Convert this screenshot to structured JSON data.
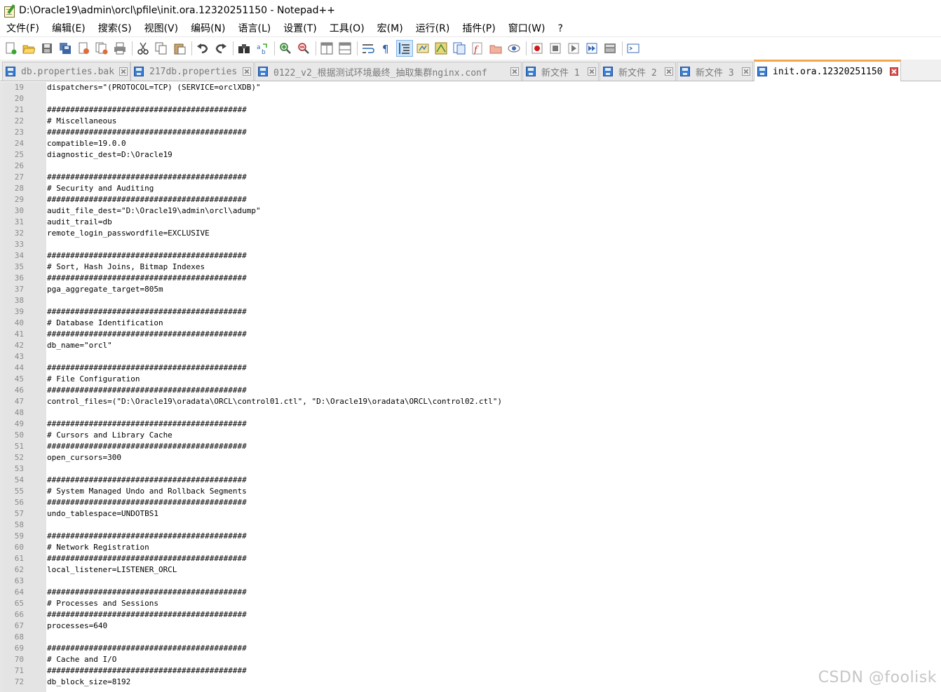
{
  "window": {
    "title": "D:\\Oracle19\\admin\\orcl\\pfile\\init.ora.12320251150 - Notepad++"
  },
  "menu": [
    {
      "label": "文件(F)"
    },
    {
      "label": "编辑(E)"
    },
    {
      "label": "搜索(S)"
    },
    {
      "label": "视图(V)"
    },
    {
      "label": "编码(N)"
    },
    {
      "label": "语言(L)"
    },
    {
      "label": "设置(T)"
    },
    {
      "label": "工具(O)"
    },
    {
      "label": "宏(M)"
    },
    {
      "label": "运行(R)"
    },
    {
      "label": "插件(P)"
    },
    {
      "label": "窗口(W)"
    },
    {
      "label": "?"
    }
  ],
  "toolbar": {
    "buttons": [
      "new-file-icon",
      "open-file-icon",
      "save-icon",
      "save-all-icon",
      "close-icon",
      "close-all-icon",
      "print-icon",
      "cut-icon",
      "copy-icon",
      "paste-icon",
      "undo-icon",
      "redo-icon",
      "find-icon",
      "replace-icon",
      "zoom-in-icon",
      "zoom-out-icon",
      "sync-vertical-icon",
      "sync-horizontal-icon",
      "word-wrap-icon",
      "show-all-chars-icon",
      "indent-guide-icon",
      "udl-icon",
      "doc-map-icon",
      "function-list-icon",
      "folder-workspace-icon",
      "monitor-icon",
      "record-macro-icon",
      "stop-record-icon",
      "play-macro-icon",
      "run-macro-multiple-icon",
      "save-macro-icon",
      "console-icon"
    ]
  },
  "tabs": [
    {
      "label": "db.properties.bak",
      "active": false
    },
    {
      "label": "217db.properties",
      "active": false
    },
    {
      "label": "0122_v2_根据测试环境最终_抽取集群nginx.conf",
      "active": false
    },
    {
      "label": "新文件 1",
      "active": false
    },
    {
      "label": "新文件 2",
      "active": false
    },
    {
      "label": "新文件 3",
      "active": false
    },
    {
      "label": "init.ora.12320251150",
      "active": true
    }
  ],
  "editor": {
    "lines": [
      {
        "n": "19",
        "t": "dispatchers=\"(PROTOCOL=TCP) (SERVICE=orclXDB)\""
      },
      {
        "n": "20",
        "t": ""
      },
      {
        "n": "21",
        "t": "###########################################"
      },
      {
        "n": "22",
        "t": "# Miscellaneous"
      },
      {
        "n": "23",
        "t": "###########################################"
      },
      {
        "n": "24",
        "t": "compatible=19.0.0"
      },
      {
        "n": "25",
        "t": "diagnostic_dest=D:\\Oracle19"
      },
      {
        "n": "26",
        "t": ""
      },
      {
        "n": "27",
        "t": "###########################################"
      },
      {
        "n": "28",
        "t": "# Security and Auditing"
      },
      {
        "n": "29",
        "t": "###########################################"
      },
      {
        "n": "30",
        "t": "audit_file_dest=\"D:\\Oracle19\\admin\\orcl\\adump\""
      },
      {
        "n": "31",
        "t": "audit_trail=db"
      },
      {
        "n": "32",
        "t": "remote_login_passwordfile=EXCLUSIVE"
      },
      {
        "n": "33",
        "t": ""
      },
      {
        "n": "34",
        "t": "###########################################"
      },
      {
        "n": "35",
        "t": "# Sort, Hash Joins, Bitmap Indexes"
      },
      {
        "n": "36",
        "t": "###########################################"
      },
      {
        "n": "37",
        "t": "pga_aggregate_target=805m"
      },
      {
        "n": "38",
        "t": ""
      },
      {
        "n": "39",
        "t": "###########################################"
      },
      {
        "n": "40",
        "t": "# Database Identification"
      },
      {
        "n": "41",
        "t": "###########################################"
      },
      {
        "n": "42",
        "t": "db_name=\"orcl\""
      },
      {
        "n": "43",
        "t": ""
      },
      {
        "n": "44",
        "t": "###########################################"
      },
      {
        "n": "45",
        "t": "# File Configuration"
      },
      {
        "n": "46",
        "t": "###########################################"
      },
      {
        "n": "47",
        "t": "control_files=(\"D:\\Oracle19\\oradata\\ORCL\\control01.ctl\", \"D:\\Oracle19\\oradata\\ORCL\\control02.ctl\")"
      },
      {
        "n": "48",
        "t": ""
      },
      {
        "n": "49",
        "t": "###########################################"
      },
      {
        "n": "50",
        "t": "# Cursors and Library Cache"
      },
      {
        "n": "51",
        "t": "###########################################"
      },
      {
        "n": "52",
        "t": "open_cursors=300"
      },
      {
        "n": "53",
        "t": ""
      },
      {
        "n": "54",
        "t": "###########################################"
      },
      {
        "n": "55",
        "t": "# System Managed Undo and Rollback Segments"
      },
      {
        "n": "56",
        "t": "###########################################"
      },
      {
        "n": "57",
        "t": "undo_tablespace=UNDOTBS1"
      },
      {
        "n": "58",
        "t": ""
      },
      {
        "n": "59",
        "t": "###########################################"
      },
      {
        "n": "60",
        "t": "# Network Registration"
      },
      {
        "n": "61",
        "t": "###########################################"
      },
      {
        "n": "62",
        "t": "local_listener=LISTENER_ORCL"
      },
      {
        "n": "63",
        "t": ""
      },
      {
        "n": "64",
        "t": "###########################################"
      },
      {
        "n": "65",
        "t": "# Processes and Sessions"
      },
      {
        "n": "66",
        "t": "###########################################"
      },
      {
        "n": "67",
        "t": "processes=640"
      },
      {
        "n": "68",
        "t": ""
      },
      {
        "n": "69",
        "t": "###########################################"
      },
      {
        "n": "70",
        "t": "# Cache and I/O"
      },
      {
        "n": "71",
        "t": "###########################################"
      },
      {
        "n": "72",
        "t": "db_block_size=8192"
      }
    ]
  },
  "watermark": "CSDN @foolisk",
  "colors": {
    "active_tab_accent": "#f6a64a",
    "tab_icon": "#3b7fd4",
    "gutter_bg": "#e4e4e4"
  }
}
